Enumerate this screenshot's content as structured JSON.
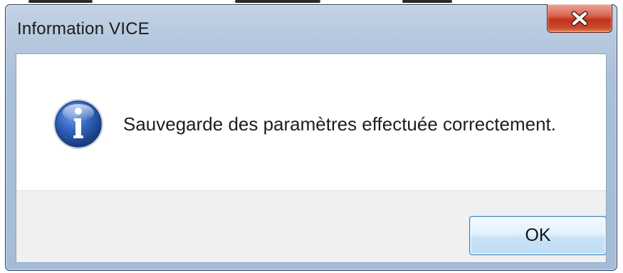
{
  "dialog": {
    "title": "Information VICE",
    "message": "Sauvegarde des paramètres effectuée correctement.",
    "icon": "information-icon",
    "close_icon": "close-icon"
  },
  "buttons": {
    "ok_label": "OK"
  },
  "colors": {
    "title_bar": "#b7c9df",
    "close_button": "#c2331c",
    "button_panel": "#f0f0f0",
    "ok_border": "#3c7fb1",
    "info_icon": "#2f5fb8"
  }
}
